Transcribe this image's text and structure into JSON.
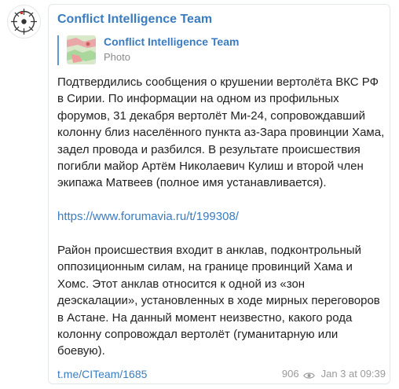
{
  "post": {
    "channel_name": "Conflict Intelligence Team",
    "forwarded": {
      "title": "Conflict Intelligence Team",
      "subtitle": "Photo"
    },
    "paragraph1": "Подтвердились сообщения о крушении вертолёта ВКС РФ в Сирии. По информации на одном из профильных форумов, 31 декабря вертолёт Ми-24, сопровождавший колонну близ населённого пункта аз-Зара провинции Хама, задел провода и разбился. В результате происшествия погибли майор Артём Николаевич Кулиш и второй член экипажа Матвеев (полное имя устанавливается).",
    "link": "https://www.forumavia.ru/t/199308/",
    "paragraph2": "Район происшествия входит в анклав, подконтрольный оппозиционным силам, на границе провинций Хама и Хомс. Этот анклав относится к одной из «зон деэскалации», установленных в ходе мирных переговоров в Астане. На данный момент неизвестно, какого рода колонну сопровождал вертолёт (гуманитарную или боевую).",
    "footer_link": "t.me/CITeam/1685",
    "views": "906",
    "date": "Jan 3 at 09:39"
  },
  "icons": {
    "avatar": "channel-logo-icon",
    "views": "eye-icon"
  },
  "colors": {
    "accent": "#3a7cbf",
    "text": "#222222",
    "meta": "#9a9a9a"
  }
}
